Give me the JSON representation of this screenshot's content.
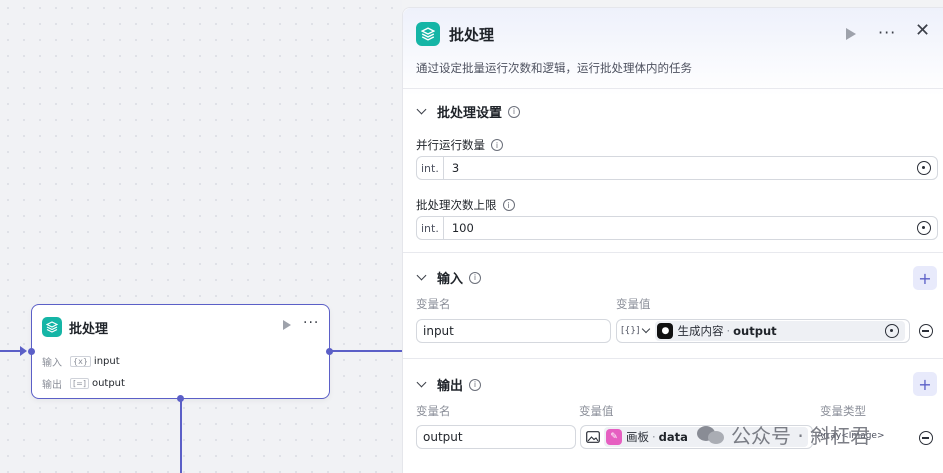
{
  "node": {
    "title": "批处理",
    "input_label": "输入",
    "input_tag_icon": "{x}",
    "input_value": "input",
    "output_label": "输出",
    "output_tag_icon": "[=]",
    "output_value": "output"
  },
  "panel": {
    "title": "批处理",
    "description": "通过设定批量运行次数和逻辑，运行批处理体内的任务",
    "settings": {
      "title": "批处理设置",
      "parallel": {
        "label": "并行运行数量",
        "type": "int.",
        "value": "3"
      },
      "limit": {
        "label": "批处理次数上限",
        "type": "int.",
        "value": "100"
      }
    },
    "inputs": {
      "title": "输入",
      "col_name": "变量名",
      "col_value": "变量值",
      "rows": [
        {
          "name": "input",
          "type_icon": "[{}]",
          "ref_source": "生成内容",
          "ref_field": "output"
        }
      ]
    },
    "outputs": {
      "title": "输出",
      "col_name": "变量名",
      "col_value": "变量值",
      "col_type": "变量类型",
      "rows": [
        {
          "name": "output",
          "ref_source": "画板",
          "ref_field": "data",
          "var_type": "Array<Image>"
        }
      ]
    }
  },
  "watermark": {
    "text": "公众号 · 斜杠君"
  },
  "colors": {
    "accent": "#5b5fc7",
    "node_icon": "#15b5a6",
    "board_icon": "#e65fc1"
  },
  "icons": [
    "layers-icon",
    "play-icon",
    "more-icon",
    "close-icon",
    "info-icon",
    "chevron-down-icon",
    "plus-icon",
    "minus-circle-icon",
    "variable-icon",
    "image-icon"
  ]
}
